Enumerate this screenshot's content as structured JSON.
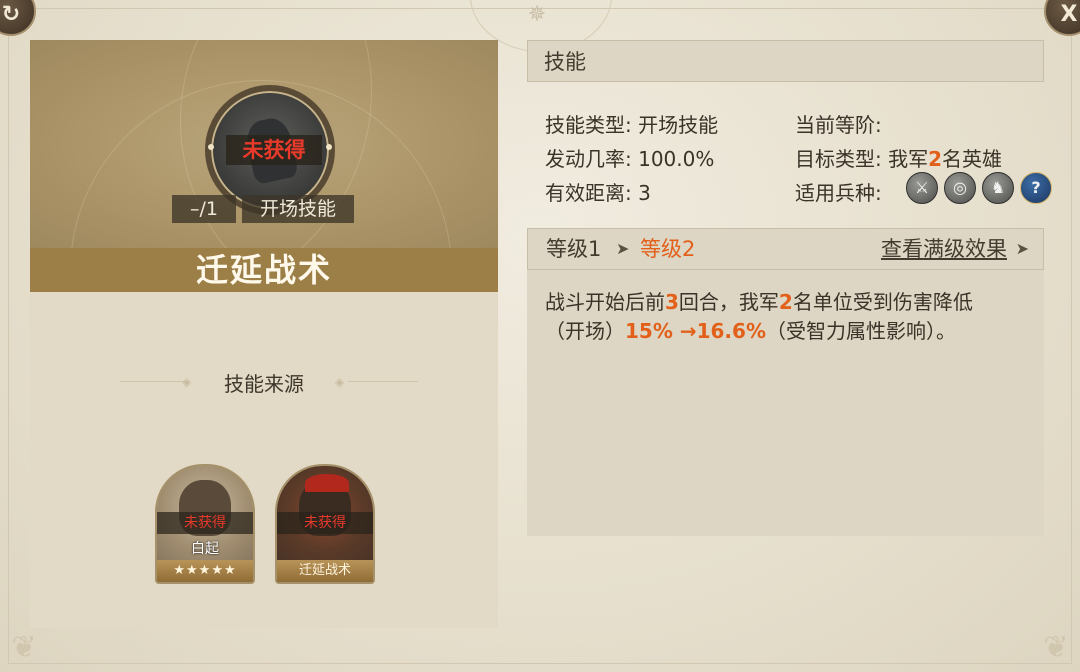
{
  "window": {
    "left_button": "↻",
    "close_button": "X"
  },
  "skill": {
    "name": "迁延战术",
    "unobtained": "未获得",
    "level_tag": "–/1",
    "type_tag": "开场技能"
  },
  "source": {
    "title": "技能来源",
    "cards": [
      {
        "status": "未获得",
        "name": "白起",
        "stars": "★★★★★"
      },
      {
        "status": "未获得",
        "label": "迁延战术"
      }
    ]
  },
  "details": {
    "header": "技能",
    "skill_type_label": "技能类型:",
    "skill_type_value": "开场技能",
    "current_rank_label": "当前等阶:",
    "trigger_rate_label": "发动几率:",
    "trigger_rate_value": "100.0%",
    "target_type_label": "目标类型:",
    "target_type_prefix": "我军",
    "target_type_count": "2",
    "target_type_suffix": "名英雄",
    "range_label": "有效距离:",
    "range_value": "3",
    "troop_label": "适用兵种:",
    "troop_icons": [
      "sword-icon",
      "target-icon",
      "horse-icon",
      "help-icon"
    ]
  },
  "levels": {
    "level1": "等级1",
    "level2": "等级2",
    "view_max": "查看满级效果"
  },
  "description": {
    "part1": "战斗开始后前",
    "rounds": "3",
    "part2": "回合，我军",
    "units": "2",
    "part3": "名单位受到伤害降低",
    "part4": "（开场）",
    "value": "15% →16.6%",
    "part5": "（受智力属性影响）。"
  },
  "colors": {
    "highlight": "#e2601a",
    "unobtained": "#e83a2a",
    "name_bar": "#9c7f47"
  }
}
